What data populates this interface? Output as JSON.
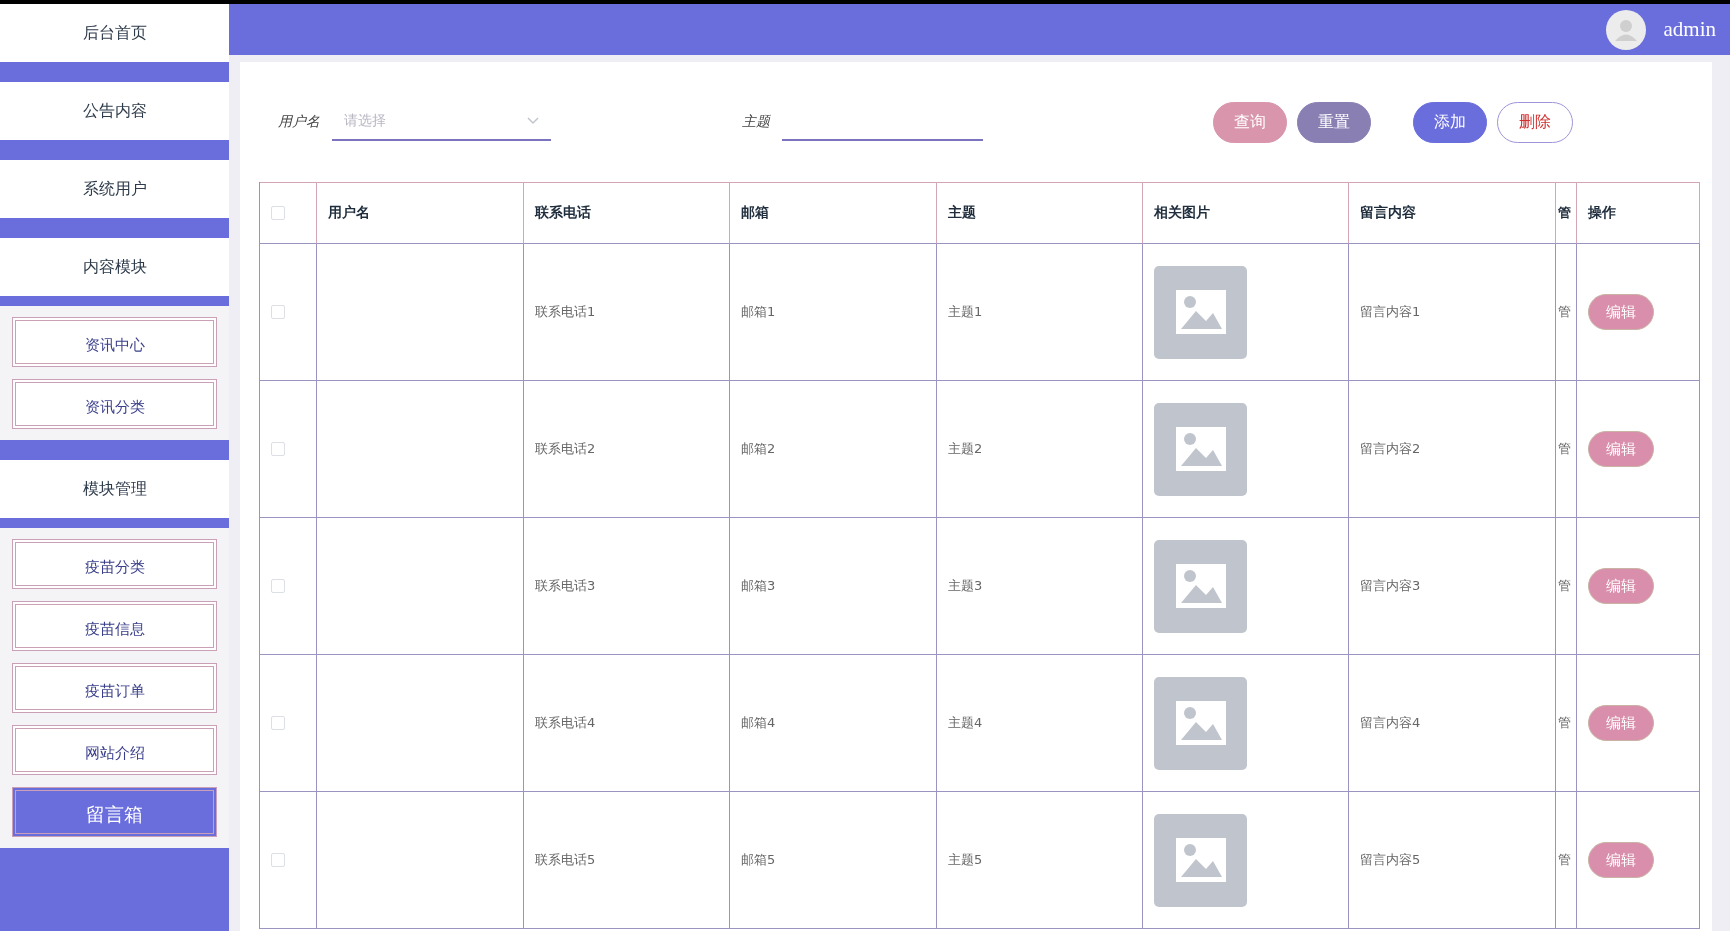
{
  "top_bar": {
    "user": "admin"
  },
  "sidebar": {
    "items": [
      {
        "label": "后台首页"
      },
      {
        "label": "公告内容"
      },
      {
        "label": "系统用户"
      },
      {
        "label": "内容模块",
        "children": [
          {
            "label": "资讯中心",
            "selected": false
          },
          {
            "label": "资讯分类",
            "selected": false
          }
        ]
      },
      {
        "label": "模块管理",
        "children": [
          {
            "label": "疫苗分类",
            "selected": false
          },
          {
            "label": "疫苗信息",
            "selected": false
          },
          {
            "label": "疫苗订单",
            "selected": false
          },
          {
            "label": "网站介绍",
            "selected": false
          },
          {
            "label": "留言箱",
            "selected": true
          }
        ]
      }
    ]
  },
  "filters": [
    {
      "label": "用户名",
      "kind": "select",
      "placeholder": "请选择"
    },
    {
      "label": "主题",
      "kind": "text"
    }
  ],
  "buttons": [
    {
      "label": "查询",
      "kind": "search"
    },
    {
      "label": "重置",
      "kind": "reset"
    },
    {
      "label": "添加",
      "kind": "add"
    },
    {
      "label": "删除",
      "kind": "delete"
    }
  ],
  "table": {
    "select_all": {
      "checked": false
    },
    "columns": [
      "用户名",
      "联系电话",
      "邮箱",
      "主题",
      "相关图片",
      "留言内容",
      "管",
      "操作"
    ],
    "rows": [
      {
        "checked": false,
        "cells": [
          "",
          "联系电话1",
          "邮箱1",
          "主题1",
          "",
          "留言内容1",
          "管"
        ],
        "action": "编辑"
      },
      {
        "checked": false,
        "cells": [
          "",
          "联系电话2",
          "邮箱2",
          "主题2",
          "",
          "留言内容2",
          "管"
        ],
        "action": "编辑"
      },
      {
        "checked": false,
        "cells": [
          "",
          "联系电话3",
          "邮箱3",
          "主题3",
          "",
          "留言内容3",
          "管"
        ],
        "action": "编辑"
      },
      {
        "checked": false,
        "cells": [
          "",
          "联系电话4",
          "邮箱4",
          "主题4",
          "",
          "留言内容4",
          "管"
        ],
        "action": "编辑"
      },
      {
        "checked": false,
        "cells": [
          "",
          "联系电话5",
          "邮箱5",
          "主题5",
          "",
          "留言内容5",
          "管"
        ],
        "action": "编辑"
      }
    ]
  }
}
